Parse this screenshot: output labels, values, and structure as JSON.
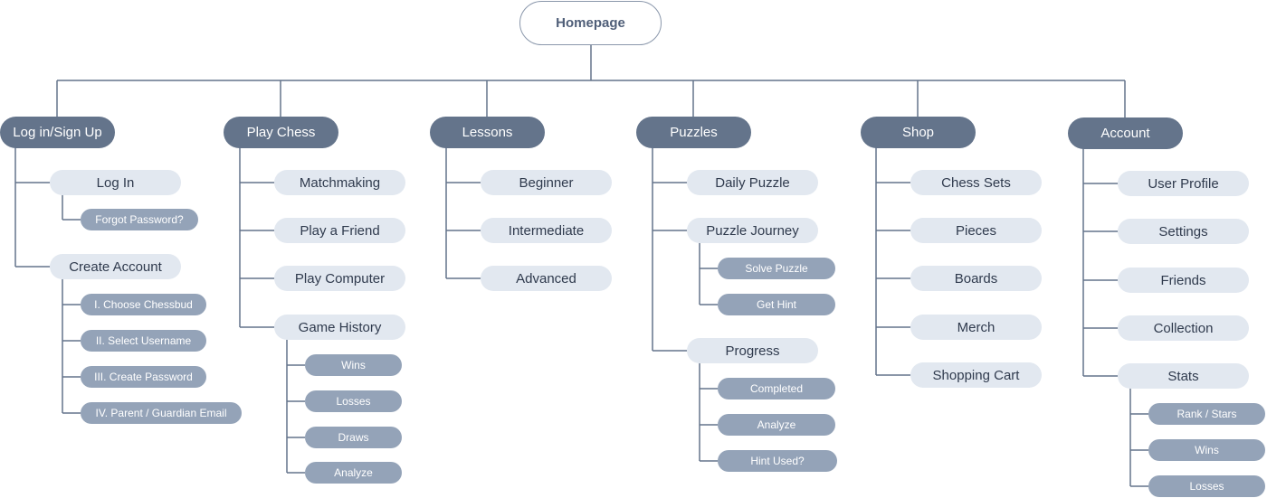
{
  "colors": {
    "line": "#64748b",
    "primary": "#64748b",
    "secondary": "#e2e8f0",
    "tertiary": "#94a3b8"
  },
  "root": {
    "label": "Homepage"
  },
  "sections": [
    {
      "label": "Log in/Sign Up",
      "children": [
        {
          "label": "Log In",
          "children": [
            {
              "label": "Forgot Password?"
            }
          ]
        },
        {
          "label": "Create Account",
          "children": [
            {
              "label": "I. Choose Chessbud"
            },
            {
              "label": "II. Select Username"
            },
            {
              "label": "III. Create Password"
            },
            {
              "label": "IV. Parent / Guardian Email"
            }
          ]
        }
      ]
    },
    {
      "label": "Play Chess",
      "children": [
        {
          "label": "Matchmaking"
        },
        {
          "label": "Play a Friend"
        },
        {
          "label": "Play Computer"
        },
        {
          "label": "Game History",
          "children": [
            {
              "label": "Wins"
            },
            {
              "label": "Losses"
            },
            {
              "label": "Draws"
            },
            {
              "label": "Analyze"
            }
          ]
        }
      ]
    },
    {
      "label": "Lessons",
      "children": [
        {
          "label": "Beginner"
        },
        {
          "label": "Intermediate"
        },
        {
          "label": "Advanced"
        }
      ]
    },
    {
      "label": "Puzzles",
      "children": [
        {
          "label": "Daily Puzzle"
        },
        {
          "label": "Puzzle Journey",
          "children": [
            {
              "label": "Solve Puzzle"
            },
            {
              "label": "Get Hint"
            }
          ]
        },
        {
          "label": "Progress",
          "children": [
            {
              "label": "Completed"
            },
            {
              "label": "Analyze"
            },
            {
              "label": "Hint Used?"
            }
          ]
        }
      ]
    },
    {
      "label": "Shop",
      "children": [
        {
          "label": "Chess Sets"
        },
        {
          "label": "Pieces"
        },
        {
          "label": "Boards"
        },
        {
          "label": "Merch"
        },
        {
          "label": "Shopping Cart"
        }
      ]
    },
    {
      "label": "Account",
      "children": [
        {
          "label": "User Profile"
        },
        {
          "label": "Settings"
        },
        {
          "label": "Friends"
        },
        {
          "label": "Collection"
        },
        {
          "label": "Stats",
          "children": [
            {
              "label": "Rank / Stars"
            },
            {
              "label": "Wins"
            },
            {
              "label": "Losses"
            }
          ]
        }
      ]
    }
  ]
}
